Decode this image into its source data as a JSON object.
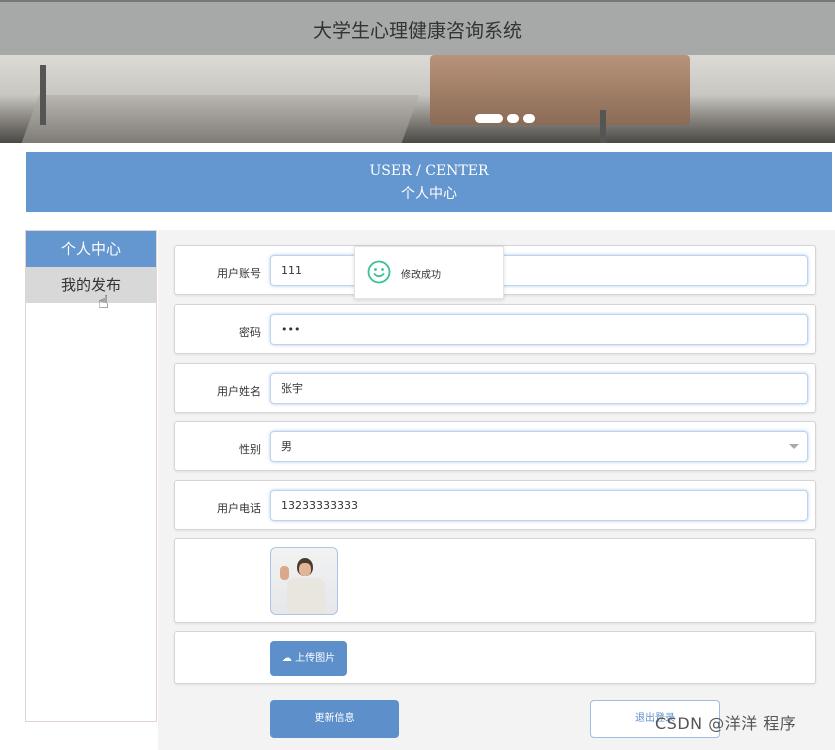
{
  "header": {
    "title": "大学生心理健康咨询系统"
  },
  "banner": {
    "slides": 3,
    "active_slide": 1
  },
  "section": {
    "title_en": "USER / CENTER",
    "title_cn": "个人中心"
  },
  "sidebar": {
    "items": [
      {
        "label": "个人中心",
        "active": true
      },
      {
        "label": "我的发布",
        "active": false
      }
    ]
  },
  "form": {
    "account": {
      "label": "用户账号",
      "value": "111"
    },
    "password": {
      "label": "密码",
      "value": "•••"
    },
    "name": {
      "label": "用户姓名",
      "value": "张宇"
    },
    "gender": {
      "label": "性别",
      "value": "男"
    },
    "phone": {
      "label": "用户电话",
      "value": "13233333333"
    },
    "upload_label": "上传图片",
    "update_label": "更新信息",
    "logout_label": "退出登录"
  },
  "toast": {
    "message": "修改成功",
    "icon": "smile-icon"
  },
  "watermark": "CSDN @洋洋 程序",
  "colors": {
    "primary": "#6496cf",
    "topbar": "#a7a9a8",
    "success": "#3cc194"
  }
}
